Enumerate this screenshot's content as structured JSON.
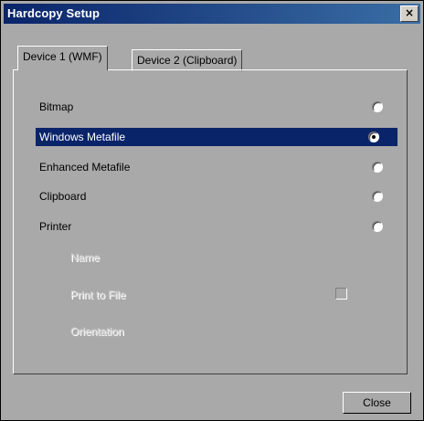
{
  "window": {
    "title": "Hardcopy Setup",
    "close_glyph": "×"
  },
  "tabs": [
    {
      "label": "Device 1 (WMF)",
      "active": true
    },
    {
      "label": "Device 2 (Clipboard)",
      "active": false
    }
  ],
  "options": [
    {
      "label": "Bitmap",
      "selected": false
    },
    {
      "label": "Windows Metafile",
      "selected": true
    },
    {
      "label": "Enhanced Metafile",
      "selected": false
    },
    {
      "label": "Clipboard",
      "selected": false
    },
    {
      "label": "Printer",
      "selected": false
    }
  ],
  "printer_settings": {
    "name_label": "Name",
    "print_to_file_label": "Print to File",
    "print_to_file_checked": false,
    "orientation_label": "Orientation"
  },
  "buttons": {
    "close_label": "Close"
  },
  "colors": {
    "selection": "#0a246a",
    "dialog_bg": "#a9a9a9"
  }
}
